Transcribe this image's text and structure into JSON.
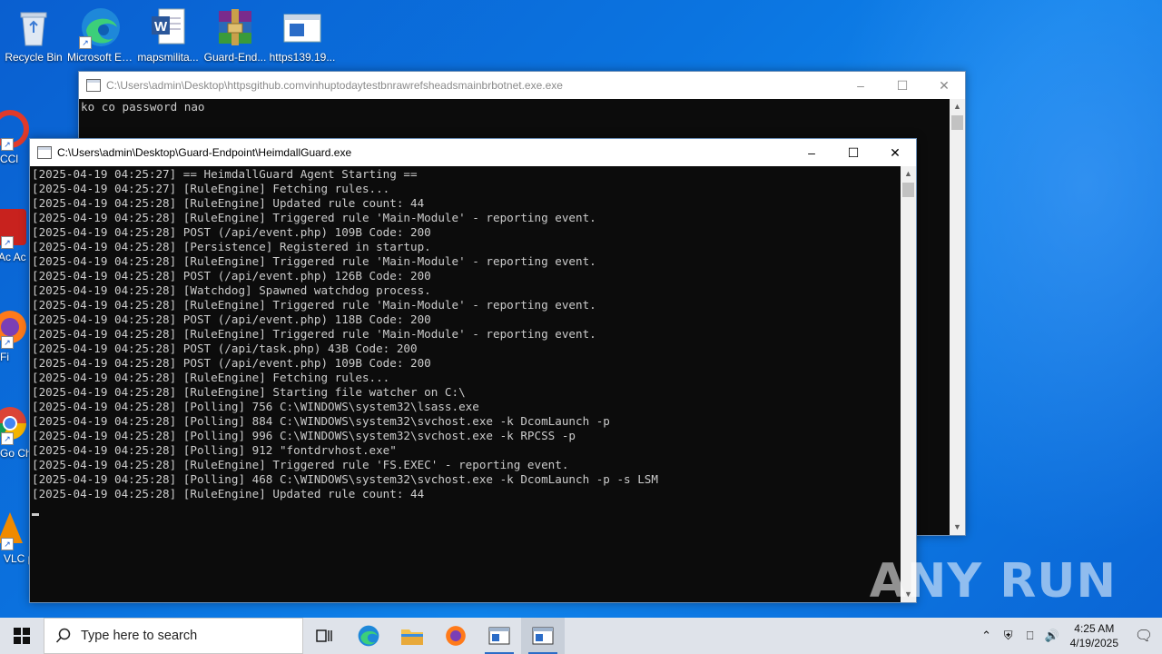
{
  "desktop": {
    "icons": [
      {
        "label": "Recycle Bin"
      },
      {
        "label": "Microsoft Edge"
      },
      {
        "label": "mapsmilita..."
      },
      {
        "label": "Guard-End..."
      },
      {
        "label": "https139.19..."
      }
    ],
    "left_partial_labels": [
      "CCl",
      "Ac Ac",
      "Fi",
      "Go Ch",
      "VLC pl"
    ]
  },
  "back_window": {
    "title": "C:\\Users\\admin\\Desktop\\httpsgithub.comvinhuptodaytestbnrawrefsheadsmainbrbotnet.exe.exe",
    "lines": [
      "ko co password nao"
    ]
  },
  "front_window": {
    "title": "C:\\Users\\admin\\Desktop\\Guard-Endpoint\\HeimdallGuard.exe",
    "lines": [
      "[2025-04-19 04:25:27] == HeimdallGuard Agent Starting ==",
      "[2025-04-19 04:25:27] [RuleEngine] Fetching rules...",
      "[2025-04-19 04:25:28] [RuleEngine] Updated rule count: 44",
      "[2025-04-19 04:25:28] [RuleEngine] Triggered rule 'Main-Module' - reporting event.",
      "[2025-04-19 04:25:28] POST (/api/event.php) 109B Code: 200",
      "[2025-04-19 04:25:28] [Persistence] Registered in startup.",
      "[2025-04-19 04:25:28] [RuleEngine] Triggered rule 'Main-Module' - reporting event.",
      "[2025-04-19 04:25:28] POST (/api/event.php) 126B Code: 200",
      "[2025-04-19 04:25:28] [Watchdog] Spawned watchdog process.",
      "[2025-04-19 04:25:28] [RuleEngine] Triggered rule 'Main-Module' - reporting event.",
      "[2025-04-19 04:25:28] POST (/api/event.php) 118B Code: 200",
      "[2025-04-19 04:25:28] [RuleEngine] Triggered rule 'Main-Module' - reporting event.",
      "[2025-04-19 04:25:28] POST (/api/task.php) 43B Code: 200",
      "[2025-04-19 04:25:28] POST (/api/event.php) 109B Code: 200",
      "[2025-04-19 04:25:28] [RuleEngine] Fetching rules...",
      "[2025-04-19 04:25:28] [RuleEngine] Starting file watcher on C:\\",
      "[2025-04-19 04:25:28] [Polling] 756 C:\\WINDOWS\\system32\\lsass.exe",
      "[2025-04-19 04:25:28] [Polling] 884 C:\\WINDOWS\\system32\\svchost.exe -k DcomLaunch -p",
      "[2025-04-19 04:25:28] [Polling] 996 C:\\WINDOWS\\system32\\svchost.exe -k RPCSS -p",
      "[2025-04-19 04:25:28] [Polling] 912 \"fontdrvhost.exe\"",
      "[2025-04-19 04:25:28] [RuleEngine] Triggered rule 'FS.EXEC' - reporting event.",
      "[2025-04-19 04:25:28] [Polling] 468 C:\\WINDOWS\\system32\\svchost.exe -k DcomLaunch -p -s LSM",
      "[2025-04-19 04:25:28] [RuleEngine] Updated rule count: 44"
    ]
  },
  "taskbar": {
    "search_placeholder": "Type here to search",
    "time": "4:25 AM",
    "date": "4/19/2025"
  },
  "watermark": "ANY RUN",
  "colors": {
    "accent": "#2b6cc7",
    "console_bg": "#0c0c0c",
    "console_fg": "#cccccc"
  }
}
